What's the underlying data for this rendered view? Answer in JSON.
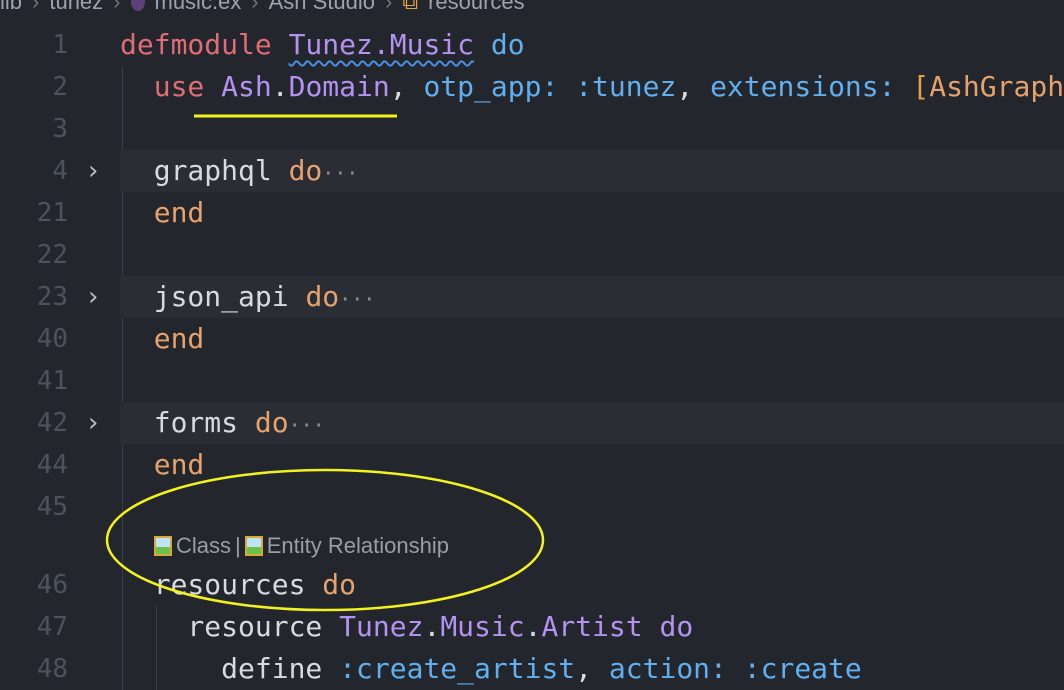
{
  "breadcrumb": [
    "lib",
    "tunez",
    "music.ex",
    "Ash Studio",
    "resources"
  ],
  "code_lens": {
    "class_label": "Class",
    "separator": "|",
    "er_label": "Entity Relationship"
  },
  "lines": [
    {
      "n": "1",
      "indent": 0,
      "tokens": [
        [
          "defmodule ",
          "kw"
        ],
        [
          "Tunez.Music",
          "mod squig"
        ],
        [
          " do",
          "blue"
        ]
      ]
    },
    {
      "n": "2",
      "indent": 1,
      "tokens": [
        [
          "  "
        ],
        [
          "use ",
          "kw"
        ],
        [
          "Ash",
          "mod"
        ],
        [
          "."
        ],
        [
          "Domain",
          "mod"
        ],
        [
          ", "
        ],
        [
          "otp_app: ",
          "blue"
        ],
        [
          ":tunez",
          "blue"
        ],
        [
          ", "
        ],
        [
          "extensions: ",
          "blue"
        ],
        [
          "[",
          "br"
        ],
        [
          "AshGraphql",
          "or"
        ]
      ]
    },
    {
      "n": "3",
      "indent": 1,
      "tokens": []
    },
    {
      "n": "4",
      "indent": 1,
      "fold": true,
      "tokens": [
        [
          "  graphql "
        ],
        [
          "do",
          "or"
        ]
      ]
    },
    {
      "n": "21",
      "indent": 1,
      "tokens": [
        [
          "  "
        ],
        [
          "end",
          "or"
        ]
      ]
    },
    {
      "n": "22",
      "indent": 1,
      "tokens": []
    },
    {
      "n": "23",
      "indent": 1,
      "fold": true,
      "tokens": [
        [
          "  json_api "
        ],
        [
          "do",
          "or"
        ]
      ]
    },
    {
      "n": "40",
      "indent": 1,
      "tokens": [
        [
          "  "
        ],
        [
          "end",
          "or"
        ]
      ]
    },
    {
      "n": "41",
      "indent": 1,
      "tokens": []
    },
    {
      "n": "42",
      "indent": 1,
      "fold": true,
      "tokens": [
        [
          "  forms "
        ],
        [
          "do",
          "or"
        ]
      ]
    },
    {
      "n": "44",
      "indent": 1,
      "tokens": [
        [
          "  "
        ],
        [
          "end",
          "or"
        ]
      ]
    },
    {
      "n": "45",
      "indent": 1,
      "tokens": [],
      "lens_after": true
    },
    {
      "n": "46",
      "indent": 1,
      "tokens": [
        [
          "  resources "
        ],
        [
          "do",
          "or"
        ]
      ]
    },
    {
      "n": "47",
      "indent": 2,
      "tokens": [
        [
          "    resource "
        ],
        [
          "Tunez",
          "mod"
        ],
        [
          "."
        ],
        [
          "Music",
          "mod"
        ],
        [
          "."
        ],
        [
          "Artist",
          "mod"
        ],
        [
          " do",
          "mod"
        ]
      ]
    },
    {
      "n": "48",
      "indent": 2,
      "tokens": [
        [
          "      define "
        ],
        [
          ":create_artist",
          "blue"
        ],
        [
          ", "
        ],
        [
          "action: ",
          "blue"
        ],
        [
          ":create",
          "blue"
        ]
      ]
    }
  ],
  "fold_icon": "chevron-right-icon",
  "colors": {
    "background": "#23262c",
    "annotation": "#f2f21e"
  }
}
